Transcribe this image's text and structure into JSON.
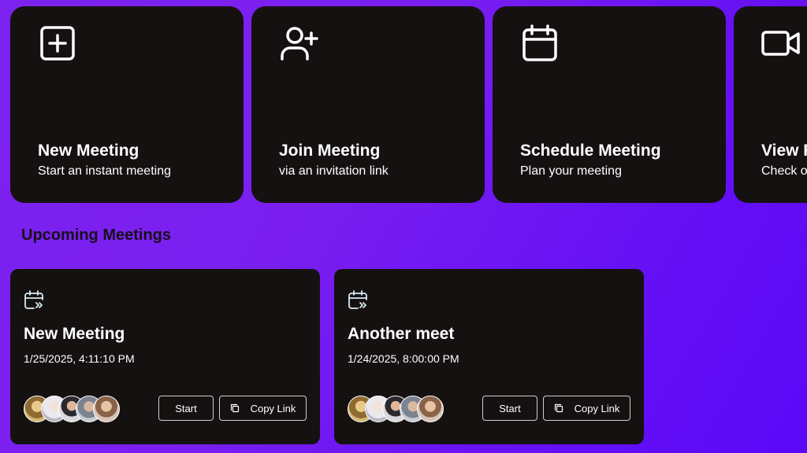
{
  "actions": [
    {
      "title": "New Meeting",
      "subtitle": "Start an instant meeting",
      "icon": "plus-square-icon"
    },
    {
      "title": "Join Meeting",
      "subtitle": "via an invitation link",
      "icon": "user-plus-icon"
    },
    {
      "title": "Schedule Meeting",
      "subtitle": "Plan your meeting",
      "icon": "calendar-icon"
    },
    {
      "title": "View Recordings",
      "subtitle": "Check out your recordings",
      "icon": "video-icon"
    }
  ],
  "upcoming": {
    "heading": "Upcoming Meetings",
    "meetings": [
      {
        "title": "New Meeting",
        "datetime": "1/25/2025, 4:11:10 PM",
        "start_label": "Start",
        "copy_label": "Copy Link",
        "icon": "calendar-arrow-icon",
        "avatar_count": 5
      },
      {
        "title": "Another meet",
        "datetime": "1/24/2025, 8:00:00 PM",
        "start_label": "Start",
        "copy_label": "Copy Link",
        "icon": "calendar-arrow-icon",
        "avatar_count": 5
      }
    ]
  },
  "colors": {
    "card_bg": "#161111",
    "background_start": "#7c22ee",
    "background_end": "#5a08f8",
    "text_primary": "#ffffff",
    "heading_text": "#16101a"
  }
}
